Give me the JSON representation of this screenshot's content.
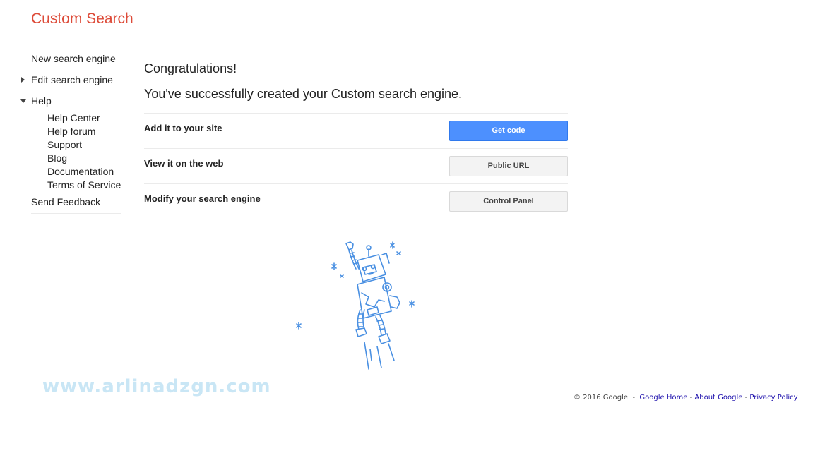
{
  "header": {
    "logo": "Custom Search"
  },
  "sidebar": {
    "new_engine": "New search engine",
    "edit_engine": "Edit search engine",
    "help": "Help",
    "help_items": [
      "Help Center",
      "Help forum",
      "Support",
      "Blog",
      "Documentation",
      "Terms of Service"
    ],
    "feedback": "Send Feedback"
  },
  "main": {
    "title": "Congratulations!",
    "subtitle": "You've successfully created your Custom search engine.",
    "rows": [
      {
        "label": "Add it to your site",
        "button": "Get code"
      },
      {
        "label": "View it on the web",
        "button": "Public URL"
      },
      {
        "label": "Modify your search engine",
        "button": "Control Panel"
      }
    ]
  },
  "watermark": "www.arlinadzgn.com",
  "footer": {
    "copyright": "© 2016 Google",
    "links": [
      "Google Home",
      "About Google",
      "Privacy Policy"
    ]
  },
  "colors": {
    "logo": "#dd4b39",
    "primary_button": "#4d90fe",
    "illustration": "#4a90e2"
  },
  "icons": {
    "collapsed": "triangle-right-icon",
    "expanded": "triangle-down-icon",
    "illustration": "robot-illustration"
  }
}
